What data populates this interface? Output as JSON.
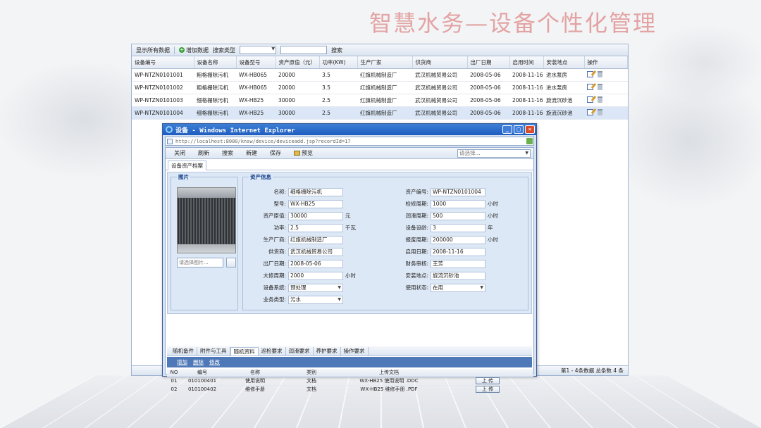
{
  "slide_title": "智慧水务—设备个性化管理",
  "toolbar": {
    "show_all": "显示所有数据",
    "add": "增加数据",
    "search_type": "搜索类型",
    "search": "搜索"
  },
  "grid": {
    "headers": [
      "设备编号",
      "设备名称",
      "设备型号",
      "资产原值（元）",
      "功率(KW)",
      "生产厂家",
      "供货商",
      "出厂日期",
      "启用时间",
      "安装地点",
      "操作"
    ],
    "rows": [
      [
        "WP-NTZN0101001",
        "粗格栅除污机",
        "WX-HB065",
        "20000",
        "3.5",
        "红旗机械制造厂",
        "武汉机械贸易公司",
        "2008-05-06",
        "2008-11-16",
        "进水泵房"
      ],
      [
        "WP-NTZN0101002",
        "粗格栅除污机",
        "WX-HB065",
        "20000",
        "3.5",
        "红旗机械制造厂",
        "武汉机械贸易公司",
        "2008-05-06",
        "2008-11-16",
        "进水泵房"
      ],
      [
        "WP-NTZN0101003",
        "细格栅除污机",
        "WX-HB25",
        "30000",
        "2.5",
        "红旗机械制造厂",
        "武汉机械贸易公司",
        "2008-05-06",
        "2008-11-16",
        "旋流沉砂池"
      ],
      [
        "WP-NTZN0101004",
        "细格栅除污机",
        "WX-HB25",
        "30000",
        "2.5",
        "红旗机械制造厂",
        "武汉机械贸易公司",
        "2008-05-06",
        "2008-11-16",
        "旋流沉砂池"
      ]
    ]
  },
  "status": "第1 - 4条数据 总条数 4 条",
  "ie": {
    "title": "设备 - Windows Internet Explorer",
    "address": "http://localhost:8080/knsw/device/deviceadd.jsp?recordId=17",
    "min": "_",
    "max": "□",
    "close": "✕"
  },
  "form_toolbar": {
    "close": "关闭",
    "refresh": "刷新",
    "search": "搜索",
    "new": "新建",
    "save": "保存",
    "preview": "预览",
    "select_placeholder": "请选择..."
  },
  "tab": "设备资产档案",
  "photo": {
    "legend": "图片",
    "placeholder": "请选择图片..."
  },
  "info": {
    "legend": "资产信息",
    "left": [
      {
        "label": "名称:",
        "value": "细格栅除污机",
        "unit": ""
      },
      {
        "label": "型号:",
        "value": "WX-HB25",
        "unit": ""
      },
      {
        "label": "资产原值:",
        "value": "30000",
        "unit": "元"
      },
      {
        "label": "功率:",
        "value": "2.5",
        "unit": "千瓦"
      },
      {
        "label": "生产厂商:",
        "value": "红旗机械制造厂",
        "unit": ""
      },
      {
        "label": "供货商:",
        "value": "武汉机械贸易公司",
        "unit": ""
      },
      {
        "label": "出厂日期:",
        "value": "2008-05-06",
        "unit": ""
      },
      {
        "label": "大修周期:",
        "value": "2000",
        "unit": "小时"
      },
      {
        "label": "设备系统:",
        "value": "预处理",
        "unit": ""
      },
      {
        "label": "业务类型:",
        "value": "污水",
        "unit": ""
      }
    ],
    "right": [
      {
        "label": "资产编号:",
        "value": "WP-NTZN0101004",
        "unit": ""
      },
      {
        "label": "检修周期:",
        "value": "1000",
        "unit": "小时"
      },
      {
        "label": "润滑周期:",
        "value": "500",
        "unit": "小时"
      },
      {
        "label": "设备设龄:",
        "value": "3",
        "unit": "年"
      },
      {
        "label": "报废周期:",
        "value": "200000",
        "unit": "小时"
      },
      {
        "label": "启用日期:",
        "value": "2008-11-16",
        "unit": ""
      },
      {
        "label": "财务审核:",
        "value": "王芳",
        "unit": ""
      },
      {
        "label": "安装地点:",
        "value": "旋流沉砂池",
        "unit": ""
      },
      {
        "label": "使用状态:",
        "value": "在用",
        "unit": ""
      }
    ]
  },
  "sub_tabs": [
    "随机备件",
    "附件与工具",
    "随机资料",
    "巡检要求",
    "润滑要求",
    "养护要求",
    "操作要求"
  ],
  "sub_toolbar": {
    "add": "增加",
    "delete": "删除",
    "modify": "修改"
  },
  "attachments": {
    "headers": [
      "NO",
      "编号",
      "名称",
      "类别",
      "上传文档"
    ],
    "rows": [
      [
        "01",
        "010100401",
        "使用说明",
        "文档",
        "WX-HB25 使用说明 .DOC",
        "上 传"
      ],
      [
        "02",
        "010100402",
        "维修手册",
        "文档",
        "WX-HB25 维修手册 .PDF",
        "上 传"
      ]
    ]
  }
}
